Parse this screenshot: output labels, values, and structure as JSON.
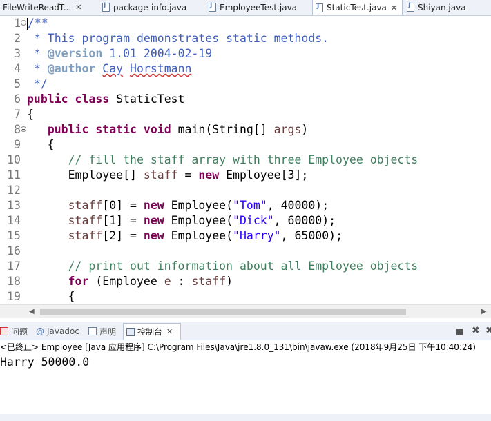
{
  "editor_tabs": [
    {
      "label": "FileWriteReadT...",
      "active": false,
      "close": "✕"
    },
    {
      "label": "package-info.java",
      "active": false
    },
    {
      "label": "EmployeeTest.java",
      "active": false
    },
    {
      "label": "StaticTest.java",
      "active": true,
      "close": "✕"
    },
    {
      "label": "Shiyan.java",
      "active": false
    }
  ],
  "code": {
    "line_numbers": [
      "1",
      "2",
      "3",
      "4",
      "5",
      "6",
      "7",
      "8",
      "9",
      "10",
      "11",
      "12",
      "13",
      "14",
      "15",
      "16",
      "17",
      "18",
      "19"
    ],
    "lines": [
      {
        "segs": [
          [
            "jdoc",
            "/**"
          ]
        ],
        "fold": true,
        "cursor": true
      },
      {
        "segs": [
          [
            "jdoc",
            " * This program demonstrates static methods."
          ]
        ]
      },
      {
        "segs": [
          [
            "jdoc",
            " * "
          ],
          [
            "tag",
            "@version"
          ],
          [
            "jdoc",
            " 1.01 2004-02-19"
          ]
        ]
      },
      {
        "segs": [
          [
            "jdoc",
            " * "
          ],
          [
            "tag",
            "@author"
          ],
          [
            "jdoc",
            " "
          ],
          [
            "jdocsq",
            "Cay"
          ],
          [
            "jdoc",
            " "
          ],
          [
            "jdocsq",
            "Horstmann"
          ]
        ]
      },
      {
        "segs": [
          [
            "jdoc",
            " */"
          ]
        ]
      },
      {
        "segs": [
          [
            "kw",
            "public"
          ],
          [
            "plain",
            " "
          ],
          [
            "kw",
            "class"
          ],
          [
            "plain",
            " StaticTest"
          ]
        ]
      },
      {
        "segs": [
          [
            "plain",
            "{"
          ]
        ]
      },
      {
        "segs": [
          [
            "plain",
            "   "
          ],
          [
            "kw",
            "public"
          ],
          [
            "plain",
            " "
          ],
          [
            "kw",
            "static"
          ],
          [
            "plain",
            " "
          ],
          [
            "kw",
            "void"
          ],
          [
            "plain",
            " main(String[] "
          ],
          [
            "var",
            "args"
          ],
          [
            "plain",
            ")"
          ]
        ],
        "fold": true
      },
      {
        "segs": [
          [
            "plain",
            "   {"
          ]
        ]
      },
      {
        "segs": [
          [
            "plain",
            "      "
          ],
          [
            "cmt",
            "// fill the staff array with three Employee objects"
          ]
        ]
      },
      {
        "segs": [
          [
            "plain",
            "      Employee[] "
          ],
          [
            "var",
            "staff"
          ],
          [
            "plain",
            " = "
          ],
          [
            "kw",
            "new"
          ],
          [
            "plain",
            " Employee[3];"
          ]
        ]
      },
      {
        "segs": [
          [
            "plain",
            ""
          ]
        ]
      },
      {
        "segs": [
          [
            "plain",
            "      "
          ],
          [
            "var",
            "staff"
          ],
          [
            "plain",
            "[0] = "
          ],
          [
            "kw",
            "new"
          ],
          [
            "plain",
            " Employee("
          ],
          [
            "str",
            "\"Tom\""
          ],
          [
            "plain",
            ", 40000);"
          ]
        ]
      },
      {
        "segs": [
          [
            "plain",
            "      "
          ],
          [
            "var",
            "staff"
          ],
          [
            "plain",
            "[1] = "
          ],
          [
            "kw",
            "new"
          ],
          [
            "plain",
            " Employee("
          ],
          [
            "str",
            "\"Dick\""
          ],
          [
            "plain",
            ", 60000);"
          ]
        ]
      },
      {
        "segs": [
          [
            "plain",
            "      "
          ],
          [
            "var",
            "staff"
          ],
          [
            "plain",
            "[2] = "
          ],
          [
            "kw",
            "new"
          ],
          [
            "plain",
            " Employee("
          ],
          [
            "str",
            "\"Harry\""
          ],
          [
            "plain",
            ", 65000);"
          ]
        ]
      },
      {
        "segs": [
          [
            "plain",
            ""
          ]
        ]
      },
      {
        "segs": [
          [
            "plain",
            "      "
          ],
          [
            "cmt",
            "// print out information about all Employee objects"
          ]
        ]
      },
      {
        "segs": [
          [
            "plain",
            "      "
          ],
          [
            "kw",
            "for"
          ],
          [
            "plain",
            " (Employee "
          ],
          [
            "var",
            "e"
          ],
          [
            "plain",
            " : "
          ],
          [
            "var",
            "staff"
          ],
          [
            "plain",
            ")"
          ]
        ]
      },
      {
        "segs": [
          [
            "plain",
            "      {"
          ]
        ]
      }
    ]
  },
  "scrollbar": {
    "left_arrow": "◀",
    "right_arrow": "▶"
  },
  "view_tabs": [
    {
      "label": "问题",
      "icon": "problems-icon",
      "active": false
    },
    {
      "label": "Javadoc",
      "icon": "javadoc-icon",
      "active": false
    },
    {
      "label": "声明",
      "icon": "declaration-icon",
      "active": false
    },
    {
      "label": "控制台",
      "icon": "console-icon",
      "active": true,
      "close": "✕"
    }
  ],
  "panel_tools": {
    "stop": "■",
    "remove": "✖",
    "remove_all": "✖"
  },
  "console": {
    "header": "<已终止> Employee [Java 应用程序] C:\\Program Files\\Java\\jre1.8.0_131\\bin\\javaw.exe  (2018年9月25日 下午10:40:24)",
    "output": "Harry 50000.0"
  },
  "colors": {
    "keyword": "#7f0055",
    "comment": "#3f7f5f",
    "javadoc": "#3f5fbf",
    "javadoc_tag": "#7f9fbf",
    "string": "#2a00ff",
    "variable": "#6a3e3e",
    "tabbar_bg": "#eef2f8"
  }
}
